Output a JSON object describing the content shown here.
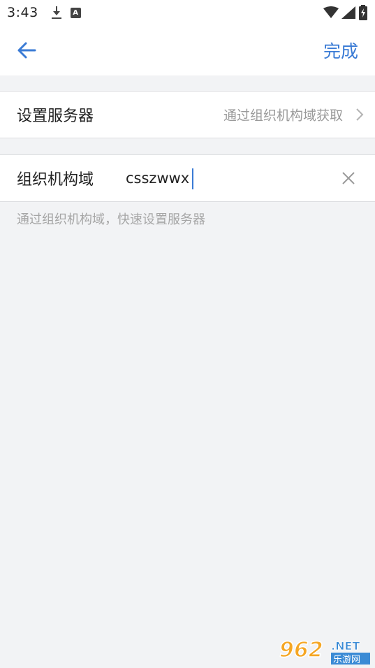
{
  "status_bar": {
    "time": "3:43",
    "notification_icons": [
      "download-icon",
      "a-notification-icon"
    ],
    "system_icons": [
      "wifi-icon",
      "signal-icon",
      "battery-icon"
    ]
  },
  "app_bar": {
    "back_icon": "arrow-left-icon",
    "done_label": "完成",
    "accent_color": "#3a7bd5"
  },
  "server_row": {
    "label": "设置服务器",
    "value": "通过组织机构域获取",
    "chevron_icon": "chevron-right-icon"
  },
  "org_row": {
    "label": "组织机构域",
    "input_value": "csszwwx",
    "clear_icon": "close-icon"
  },
  "hint": "通过组织机构域，快速设置服务器",
  "watermark": {
    "brand": "962",
    "suffix": ".NET",
    "tagline": "乐游网"
  }
}
